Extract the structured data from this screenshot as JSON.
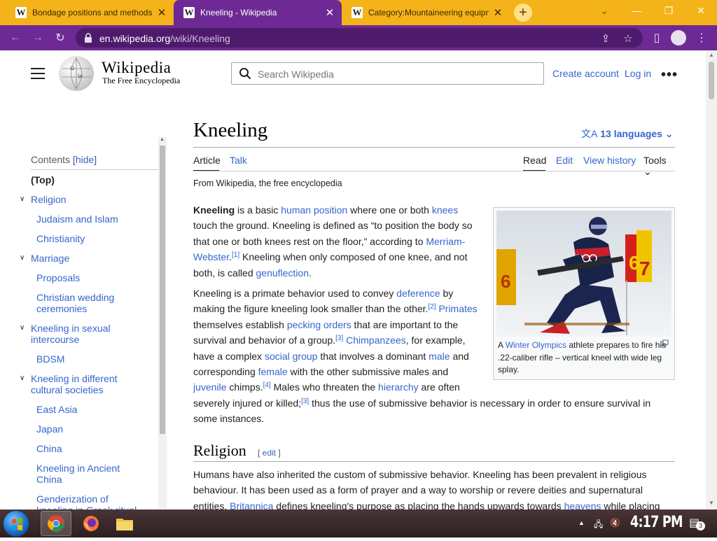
{
  "browser": {
    "tabs": [
      {
        "title": "Bondage positions and methods",
        "favicon": "W",
        "active": false
      },
      {
        "title": "Kneeling - Wikipedia",
        "favicon": "W",
        "active": true
      },
      {
        "title": "Category:Mountaineering equipment",
        "favicon": "W",
        "active": false
      }
    ],
    "new_tab_icon": "plus-icon",
    "url_domain": "en.wikipedia.org",
    "url_path": "/wiki/Kneeling",
    "accent_color": "#6d2a95",
    "tabstrip_color": "#f4b318"
  },
  "header": {
    "wordmark": "Wikipedia",
    "tagline": "The Free Encyclopedia",
    "search_placeholder": "Search Wikipedia",
    "create_account": "Create account",
    "log_in": "Log in"
  },
  "toc": {
    "title": "Contents",
    "hide": "hide",
    "items": [
      {
        "label": "(Top)",
        "level": 0,
        "collapsible": false
      },
      {
        "label": "Religion",
        "level": 0,
        "collapsible": true
      },
      {
        "label": "Judaism and Islam",
        "level": 1
      },
      {
        "label": "Christianity",
        "level": 1
      },
      {
        "label": "Marriage",
        "level": 0,
        "collapsible": true
      },
      {
        "label": "Proposals",
        "level": 1
      },
      {
        "label": "Christian wedding ceremonies",
        "level": 1
      },
      {
        "label": "Kneeling in sexual intercourse",
        "level": 0,
        "collapsible": true
      },
      {
        "label": "BDSM",
        "level": 1
      },
      {
        "label": "Kneeling in different cultural societies",
        "level": 0,
        "collapsible": true
      },
      {
        "label": "East Asia",
        "level": 1
      },
      {
        "label": "Japan",
        "level": 1
      },
      {
        "label": "China",
        "level": 1
      },
      {
        "label": "Kneeling in Ancient China",
        "level": 1
      },
      {
        "label": "Genderization of kneeling in Greek ritual",
        "level": 1
      }
    ]
  },
  "article": {
    "title": "Kneeling",
    "languages": "13 languages",
    "tabs": {
      "article": "Article",
      "talk": "Talk",
      "read": "Read",
      "edit": "Edit",
      "history": "View history",
      "tools": "Tools"
    },
    "from": "From Wikipedia, the free encyclopedia",
    "image_caption_pre": "A ",
    "image_caption_link": "Winter Olympics",
    "image_caption_post": " athlete prepares to fire his .22-caliber rifle – vertical kneel with wide leg splay.",
    "section_religion": "Religion",
    "section_edit": "edit"
  },
  "taskbar": {
    "time": "4:17 PM",
    "notification_count": "3",
    "apps": [
      "windows-start-icon",
      "chrome-icon",
      "firefox-icon",
      "file-explorer-icon"
    ]
  }
}
